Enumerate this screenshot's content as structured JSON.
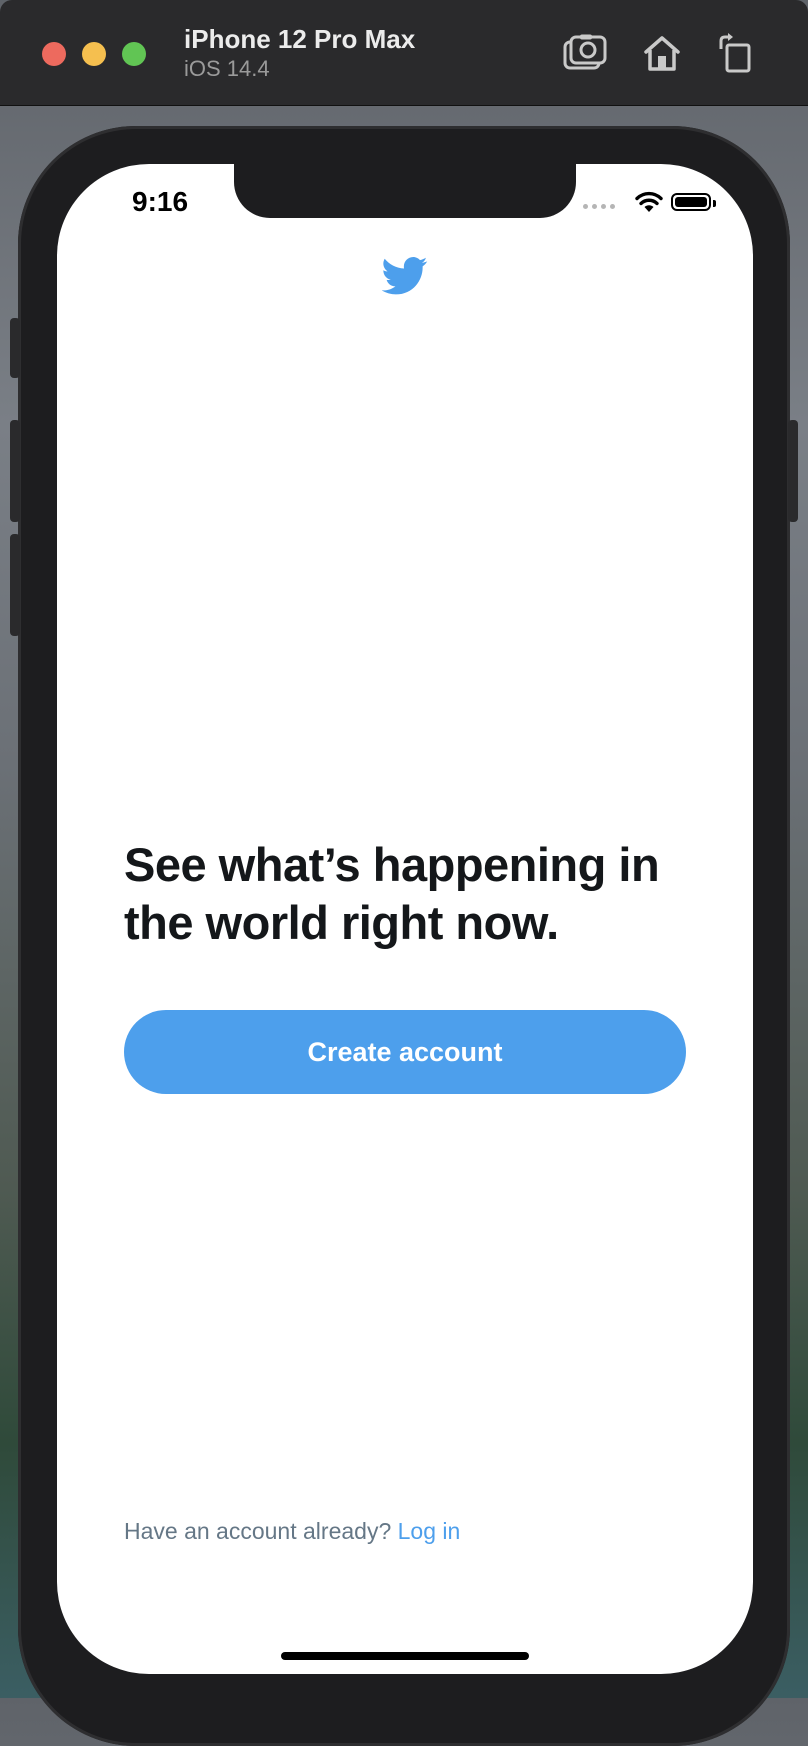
{
  "simulator": {
    "device_name": "iPhone 12 Pro Max",
    "os_version": "iOS 14.4",
    "toolbar_icons": [
      "screenshot-icon",
      "home-icon",
      "rotate-icon"
    ]
  },
  "status_bar": {
    "time": "9:16"
  },
  "app": {
    "logo_icon": "twitter-bird-icon",
    "brand_color": "#4d9fec",
    "headline": "See what’s happening in the world right now.",
    "create_button_label": "Create account",
    "login_prompt": "Have an account already?",
    "login_link": "Log in"
  }
}
